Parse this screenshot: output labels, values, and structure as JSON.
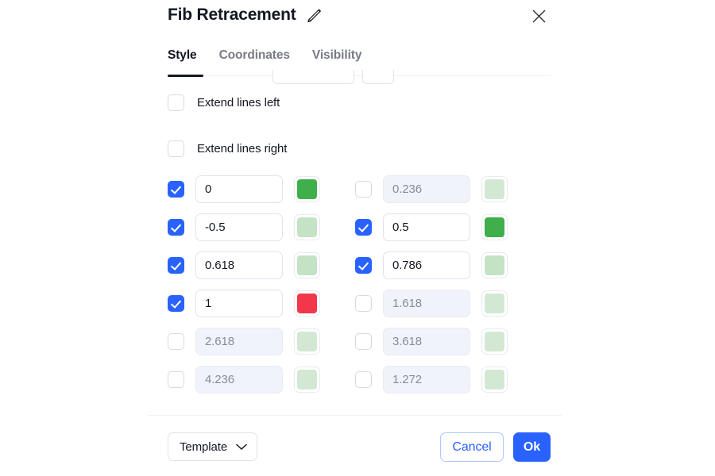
{
  "dialog": {
    "title": "Fib Retracement",
    "edit_icon": "pencil-icon",
    "close_icon": "close-icon"
  },
  "tabs": [
    {
      "label": "Style",
      "active": true
    },
    {
      "label": "Coordinates",
      "active": false
    },
    {
      "label": "Visibility",
      "active": false
    }
  ],
  "options": [
    {
      "label": "Extend lines left",
      "checked": false
    },
    {
      "label": "Extend lines right",
      "checked": false
    }
  ],
  "levels": [
    {
      "value": "0",
      "checked": true,
      "color": "#3eaf4a"
    },
    {
      "value": "0.236",
      "checked": false,
      "color": "#d2e8d3"
    },
    {
      "value": "-0.5",
      "checked": true,
      "color": "#c3e3c4"
    },
    {
      "value": "0.5",
      "checked": true,
      "color": "#3eaf4a"
    },
    {
      "value": "0.618",
      "checked": true,
      "color": "#c3e3c4"
    },
    {
      "value": "0.786",
      "checked": true,
      "color": "#c3e3c4"
    },
    {
      "value": "1",
      "checked": true,
      "color": "#f2374a"
    },
    {
      "value": "1.618",
      "checked": false,
      "color": "#d2e8d3"
    },
    {
      "value": "2.618",
      "checked": false,
      "color": "#d2e8d3"
    },
    {
      "value": "3.618",
      "checked": false,
      "color": "#d2e8d3"
    },
    {
      "value": "4.236",
      "checked": false,
      "color": "#d2e8d3"
    },
    {
      "value": "1.272",
      "checked": false,
      "color": "#d2e8d3"
    }
  ],
  "footer": {
    "template_label": "Template",
    "template_chevron": "chevron-down-icon",
    "cancel_label": "Cancel",
    "ok_label": "Ok"
  },
  "colors": {
    "accent": "#2962ff",
    "text": "#131722",
    "muted": "#787b86",
    "border": "#e0e3eb",
    "disabled_bg": "#f0f3f9"
  }
}
